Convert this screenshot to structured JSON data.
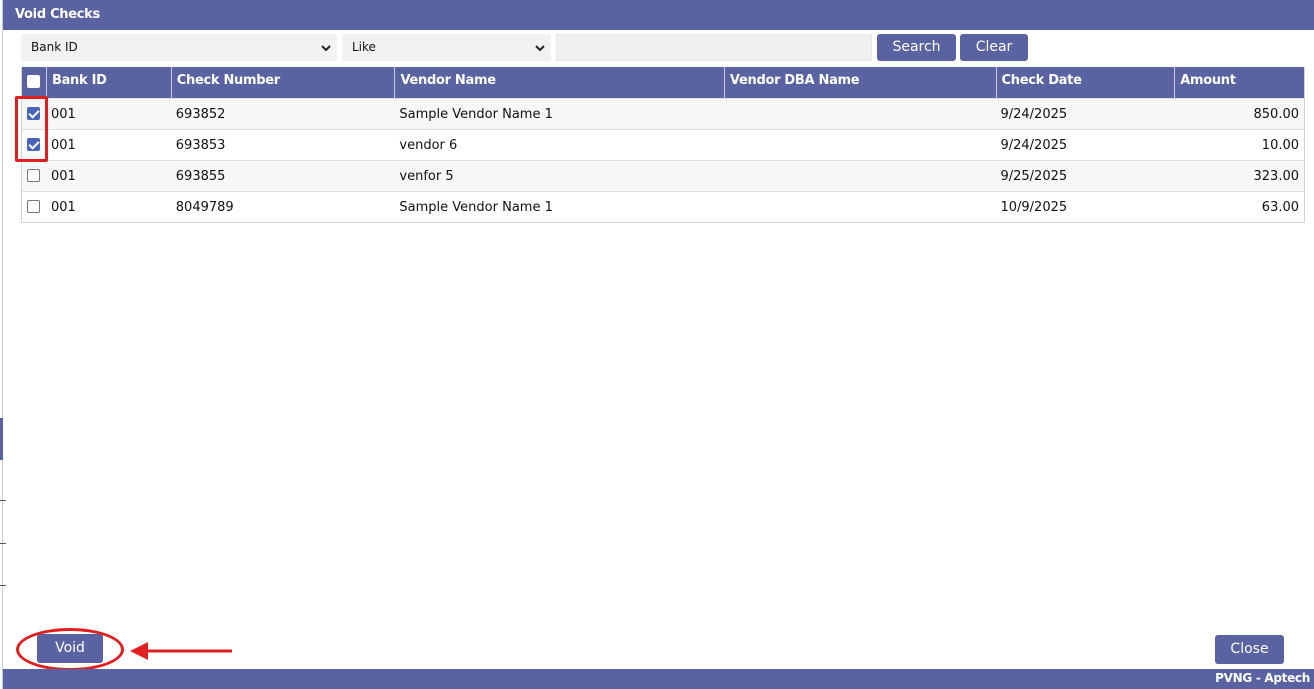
{
  "window": {
    "title": "Void Checks"
  },
  "filters": {
    "field_value": "Bank ID",
    "operator_value": "Like",
    "search_value": "",
    "search_label": "Search",
    "clear_label": "Clear"
  },
  "table": {
    "columns": [
      "Bank ID",
      "Check Number",
      "Vendor Name",
      "Vendor DBA Name",
      "Check Date",
      "Amount"
    ],
    "rows": [
      {
        "checked": true,
        "bank_id": "001",
        "check_number": "693852",
        "vendor_name": "Sample Vendor Name 1",
        "vendor_dba_name": "",
        "check_date": "9/24/2025",
        "amount": "850.00"
      },
      {
        "checked": true,
        "bank_id": "001",
        "check_number": "693853",
        "vendor_name": "vendor 6",
        "vendor_dba_name": "",
        "check_date": "9/24/2025",
        "amount": "10.00"
      },
      {
        "checked": false,
        "bank_id": "001",
        "check_number": "693855",
        "vendor_name": "venfor 5",
        "vendor_dba_name": "",
        "check_date": "9/25/2025",
        "amount": "323.00"
      },
      {
        "checked": false,
        "bank_id": "001",
        "check_number": "8049789",
        "vendor_name": "Sample Vendor Name 1",
        "vendor_dba_name": "",
        "check_date": "10/9/2025",
        "amount": "63.00"
      }
    ]
  },
  "actions": {
    "void_label": "Void",
    "close_label": "Close"
  },
  "footer": {
    "brand": "PVNG - Aptech"
  },
  "colors": {
    "accent": "#5a63a2",
    "annotation": "#e02020",
    "checkbox": "#4a64b9"
  }
}
